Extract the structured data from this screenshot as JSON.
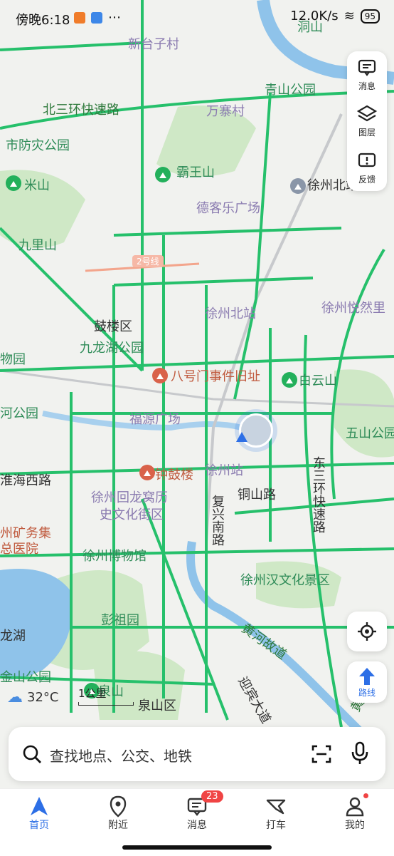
{
  "status": {
    "time": "傍晚6:18",
    "speed": "12.0K/s",
    "battery": "95"
  },
  "map_labels": [
    {
      "text": "新台子村",
      "cls": "place"
    },
    {
      "text": "青山公园",
      "cls": "green"
    },
    {
      "text": "北三环快速路",
      "cls": "road"
    },
    {
      "text": "万寨村",
      "cls": "place"
    },
    {
      "text": "市防灾公园",
      "cls": "green"
    },
    {
      "text": "霸王山",
      "cls": "green"
    },
    {
      "text": "米山",
      "cls": "green"
    },
    {
      "text": "徐州北站",
      "cls": "dark"
    },
    {
      "text": "德客乐广场",
      "cls": "place"
    },
    {
      "text": "九里山",
      "cls": "green"
    },
    {
      "text": "2号线",
      "cls": "dark"
    },
    {
      "text": "徐州北站",
      "cls": "place"
    },
    {
      "text": "徐州悦然里",
      "cls": "place"
    },
    {
      "text": "鼓楼区",
      "cls": "dark"
    },
    {
      "text": "九龙湖公园",
      "cls": "green"
    },
    {
      "text": "八号门事件旧址",
      "cls": "poi"
    },
    {
      "text": "白云山",
      "cls": "green"
    },
    {
      "text": "物园",
      "cls": "green"
    },
    {
      "text": "福源广场",
      "cls": "place"
    },
    {
      "text": "河公园",
      "cls": "green"
    },
    {
      "text": "五山公园",
      "cls": "green"
    },
    {
      "text": "钟鼓楼",
      "cls": "poi"
    },
    {
      "text": "徐州站",
      "cls": "place"
    },
    {
      "text": "淮海西路",
      "cls": "dark"
    },
    {
      "text": "徐州回龙窝历",
      "cls": "place"
    },
    {
      "text": "史文化街区",
      "cls": "place"
    },
    {
      "text": "铜山路",
      "cls": "dark"
    },
    {
      "text": "复兴南路",
      "cls": "dark"
    },
    {
      "text": "东三环快速路",
      "cls": "dark"
    },
    {
      "text": "州矿务集",
      "cls": "poi"
    },
    {
      "text": "总医院",
      "cls": "poi"
    },
    {
      "text": "徐州博物馆",
      "cls": "green"
    },
    {
      "text": "徐州汉文化景区",
      "cls": "green"
    },
    {
      "text": "彭祖园",
      "cls": "green"
    },
    {
      "text": "黄河故道",
      "cls": "road"
    },
    {
      "text": "龙湖",
      "cls": "dark"
    },
    {
      "text": "迎宾大道",
      "cls": "dark"
    },
    {
      "text": "金山公园",
      "cls": "green"
    },
    {
      "text": "泉山",
      "cls": "green"
    },
    {
      "text": "泉山区",
      "cls": "dark"
    },
    {
      "text": "黄河",
      "cls": "road"
    },
    {
      "text": "洞山",
      "cls": "green"
    }
  ],
  "side_panel": {
    "messages": "消息",
    "layers": "图层",
    "feedback": "反馈"
  },
  "route_label": "路线",
  "weather": {
    "temp": "32°C"
  },
  "scale": "1公里",
  "search": {
    "placeholder": "查找地点、公交、地铁"
  },
  "nav": [
    {
      "label": "首页",
      "active": true
    },
    {
      "label": "附近"
    },
    {
      "label": "消息",
      "badge": "23"
    },
    {
      "label": "打车"
    },
    {
      "label": "我的"
    }
  ],
  "colors": {
    "road_green": "#26c06b",
    "water": "#8fc3ea",
    "park": "#cfe8c6",
    "accent": "#2d6fe6"
  }
}
